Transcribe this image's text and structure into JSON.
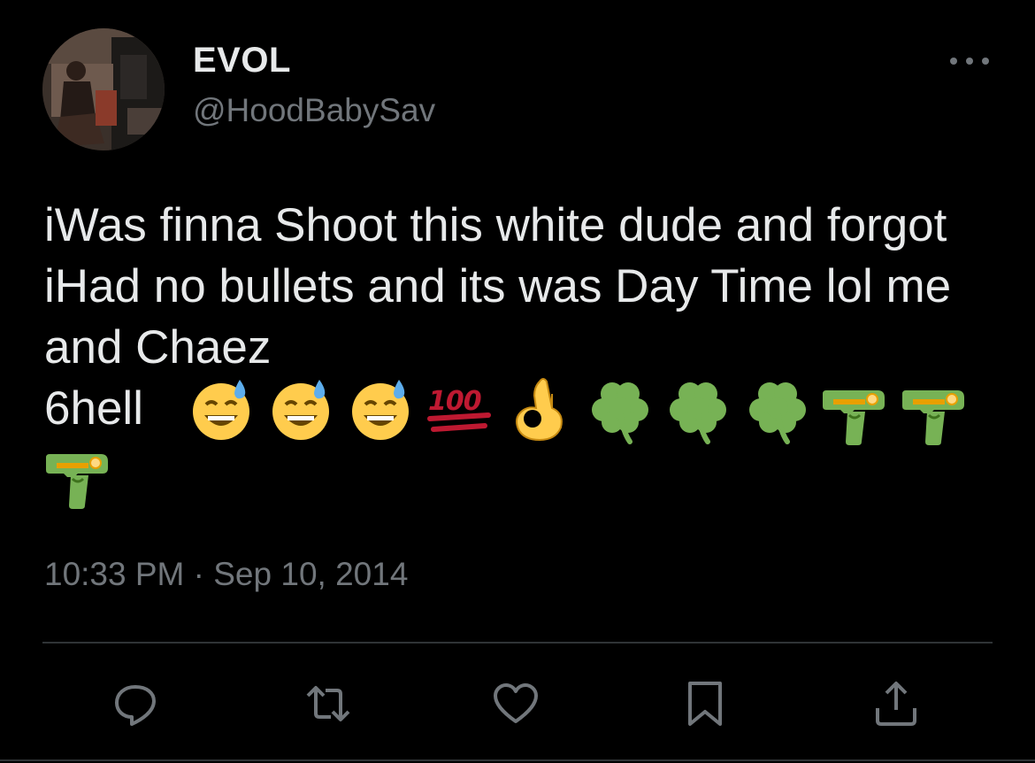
{
  "author": {
    "display_name": "EVOL",
    "handle": "@HoodBabySav",
    "avatar_icon": "profile-photo"
  },
  "tweet": {
    "text": "iWas finna Shoot this white dude and forgot iHad no bullets and its was Day Time lol me and Chaez",
    "last_word": "6hell",
    "emojis": [
      "sweat-smile-emoji",
      "sweat-smile-emoji",
      "sweat-smile-emoji",
      "hundred-points-emoji",
      "ok-hand-emoji",
      "shamrock-emoji",
      "shamrock-emoji",
      "shamrock-emoji",
      "water-pistol-emoji",
      "water-pistol-emoji",
      "water-pistol-emoji"
    ],
    "timestamp": "10:33 PM · Sep 10, 2014"
  },
  "actions": [
    {
      "name": "reply",
      "icon": "reply-icon"
    },
    {
      "name": "retweet",
      "icon": "retweet-icon"
    },
    {
      "name": "like",
      "icon": "heart-icon"
    },
    {
      "name": "bookmark",
      "icon": "bookmark-icon"
    },
    {
      "name": "share",
      "icon": "share-icon"
    }
  ],
  "colors": {
    "background": "#000000",
    "primary_text": "#e7e9ea",
    "secondary_text": "#71767b",
    "divider": "#2f3336"
  }
}
